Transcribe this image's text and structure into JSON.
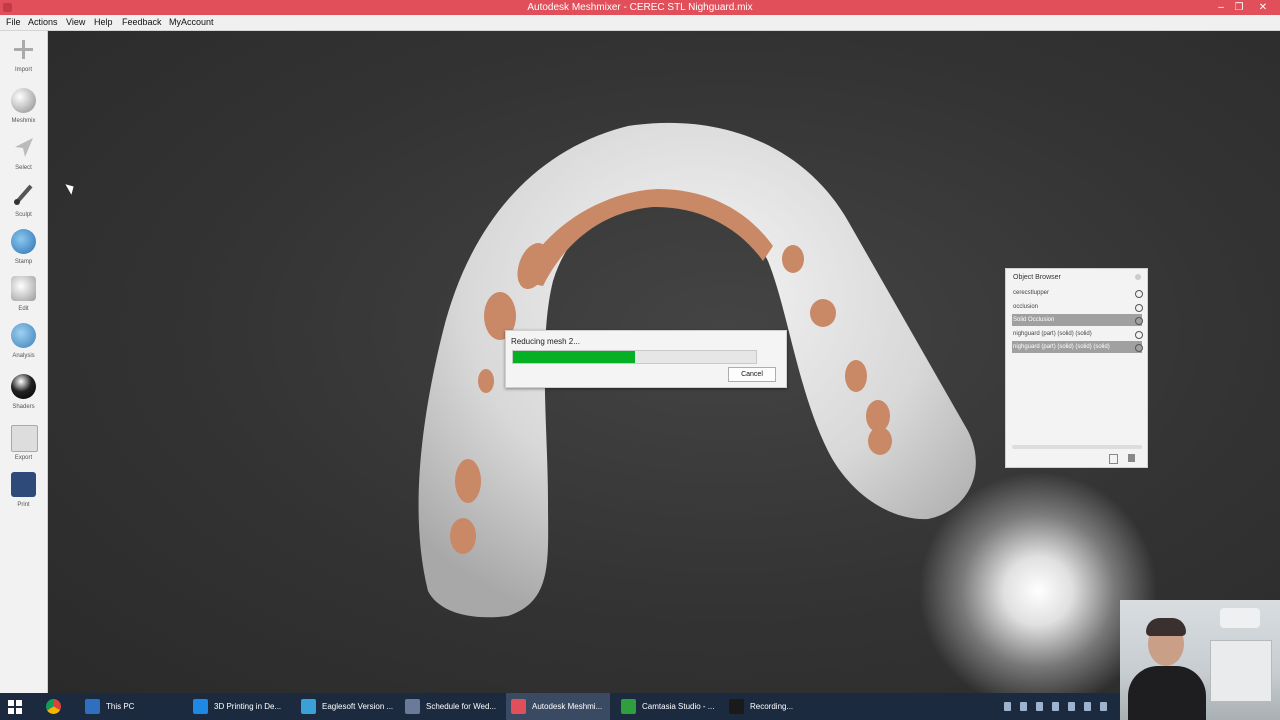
{
  "window": {
    "title": "Autodesk Meshmixer - CEREC STL Nighguard.mix"
  },
  "menu": {
    "items": [
      "File",
      "Actions",
      "View",
      "Help",
      "Feedback",
      "MyAccount"
    ]
  },
  "tools": [
    "Import",
    "Meshmix",
    "Select",
    "Sculpt",
    "Stamp",
    "Edit",
    "Analysis",
    "Shaders",
    "Export",
    "Print"
  ],
  "progress": {
    "title": "Reducing mesh 2...",
    "fraction": 0.5,
    "cancel_label": "Cancel"
  },
  "object_browser": {
    "title": "Object Browser",
    "items": [
      {
        "name": "cerecstlupper",
        "selected": false
      },
      {
        "name": "occlusion",
        "selected": false
      },
      {
        "name": "Solid Occlusion",
        "selected": true
      },
      {
        "name": "nighguard (part) (solid) (solid)",
        "selected": false
      },
      {
        "name": "nighguard (part) (solid) (solid) (solid)",
        "selected": true
      }
    ]
  },
  "taskbar": {
    "items": [
      {
        "label": "This PC",
        "icon": "folder-icon",
        "color": "#2f6fbf"
      },
      {
        "label": "3D Printing in De...",
        "icon": "ie-icon",
        "color": "#1e88e5"
      },
      {
        "label": "Eaglesoft Version ...",
        "icon": "eaglesoft-icon",
        "color": "#3aa0d8"
      },
      {
        "label": "Schedule for Wed...",
        "icon": "schedule-icon",
        "color": "#6b7a99"
      },
      {
        "label": "Autodesk Meshmi...",
        "icon": "meshmixer-icon",
        "color": "#e1505a"
      },
      {
        "label": "Camtasia Studio - ...",
        "icon": "camtasia-icon",
        "color": "#2e9e3f"
      },
      {
        "label": "Recording...",
        "icon": "recording-icon",
        "color": "#1a1a1a"
      }
    ]
  },
  "colors": {
    "accent": "#e1505a",
    "progress_fill": "#06b025",
    "mesh": "#e8e8e8",
    "occlusion": "#c98866"
  }
}
